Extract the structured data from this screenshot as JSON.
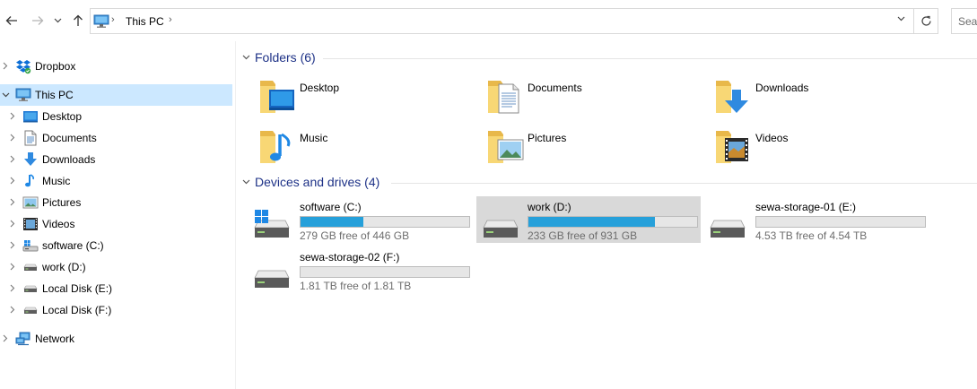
{
  "address_bar": {
    "breadcrumb": [
      "This PC"
    ],
    "search_placeholder": "Sear"
  },
  "sidebar": {
    "items": [
      {
        "label": "Dropbox",
        "icon": "dropbox-icon"
      },
      {
        "label": "This PC",
        "icon": "computer-icon",
        "selected": true,
        "expanded": true
      },
      {
        "label": "Desktop",
        "icon": "desktop-icon"
      },
      {
        "label": "Documents",
        "icon": "documents-icon"
      },
      {
        "label": "Downloads",
        "icon": "downloads-icon"
      },
      {
        "label": "Music",
        "icon": "music-icon"
      },
      {
        "label": "Pictures",
        "icon": "pictures-icon"
      },
      {
        "label": "Videos",
        "icon": "videos-icon"
      },
      {
        "label": "software (C:)",
        "icon": "windows-drive-icon"
      },
      {
        "label": "work (D:)",
        "icon": "drive-icon"
      },
      {
        "label": "Local Disk (E:)",
        "icon": "drive-icon"
      },
      {
        "label": "Local Disk (F:)",
        "icon": "drive-icon"
      },
      {
        "label": "Network",
        "icon": "network-icon"
      }
    ]
  },
  "folders_section": {
    "title": "Folders (6)",
    "items": [
      {
        "label": "Desktop",
        "icon": "desktop-folder-icon"
      },
      {
        "label": "Documents",
        "icon": "documents-folder-icon"
      },
      {
        "label": "Downloads",
        "icon": "downloads-folder-icon"
      },
      {
        "label": "Music",
        "icon": "music-folder-icon"
      },
      {
        "label": "Pictures",
        "icon": "pictures-folder-icon"
      },
      {
        "label": "Videos",
        "icon": "videos-folder-icon"
      }
    ]
  },
  "drives_section": {
    "title": "Devices and drives (4)",
    "items": [
      {
        "name": "software (C:)",
        "free_text": "279 GB free of 446 GB",
        "used_fraction": 0.37,
        "icon": "windows-drive-icon",
        "selected": false
      },
      {
        "name": "work (D:)",
        "free_text": "233 GB free of 931 GB",
        "used_fraction": 0.75,
        "icon": "drive-icon",
        "selected": true
      },
      {
        "name": "sewa-storage-01 (E:)",
        "free_text": "4.53 TB free of 4.54 TB",
        "used_fraction": 0.0,
        "icon": "drive-icon",
        "selected": false
      },
      {
        "name": "sewa-storage-02 (F:)",
        "free_text": "1.81 TB free of 1.81 TB",
        "used_fraction": 0.0,
        "icon": "drive-icon",
        "selected": false
      }
    ]
  },
  "colors": {
    "accent": "#26a0da",
    "selection": "#cce8ff",
    "section_title": "#1e3287",
    "folder_yellow": "#f8d775"
  }
}
